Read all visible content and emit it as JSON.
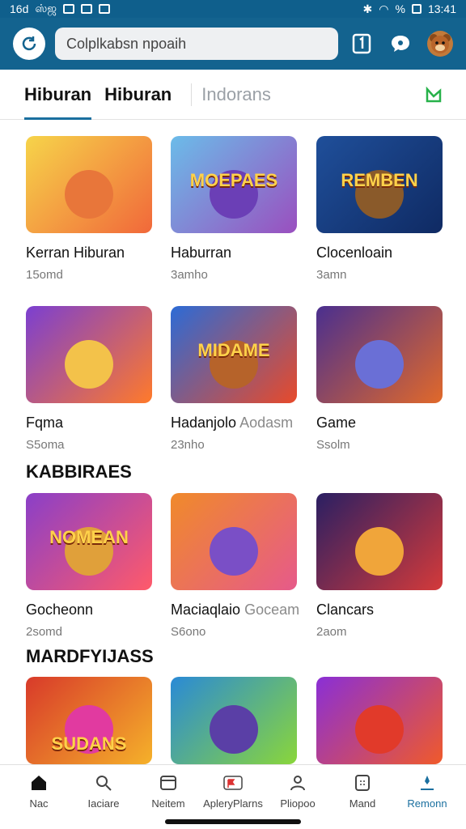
{
  "status": {
    "time_left": "16d",
    "carrier": "ஸ்ஜ",
    "battery": "%",
    "clock": "13:41"
  },
  "search": {
    "value": "Colplkabsn npoaih"
  },
  "tabs": [
    {
      "label": "Hiburan"
    },
    {
      "label": "Hiburan"
    },
    {
      "label": "Indorans"
    }
  ],
  "cards": [
    {
      "title": "Kerran Hiburan",
      "extra": "",
      "sub": "15omd",
      "thumb_text": "",
      "bg1": "#f6d44a",
      "bg2": "#f1683a",
      "m": "#e8763a"
    },
    {
      "title": "Haburran",
      "extra": "",
      "sub": "3amho",
      "thumb_text": "MOEPAES",
      "bg1": "#6bbce9",
      "bg2": "#9a4fbf",
      "m": "#6b3fb6"
    },
    {
      "title": "Clocenloain",
      "extra": "",
      "sub": "3amn",
      "thumb_text": "REMBEN",
      "bg1": "#1f4f9a",
      "bg2": "#0f2a63",
      "m": "#8a5a2a"
    },
    {
      "title": "Fqma",
      "extra": "",
      "sub": "S5oma",
      "thumb_text": "",
      "bg1": "#7b3fd1",
      "bg2": "#ff7a2a",
      "m": "#f3c24a"
    },
    {
      "title": "Hadanjolo",
      "extra": "Aodasm",
      "sub": "23nho",
      "thumb_text": "MIDAME",
      "bg1": "#2c6bd6",
      "bg2": "#e84a2a",
      "m": "#b6632a"
    },
    {
      "title": "Game",
      "extra": "",
      "sub": "Ssolm",
      "thumb_text": "",
      "bg1": "#4a2f8f",
      "bg2": "#e1692a",
      "m": "#6a6fd6"
    },
    {
      "title": "Gocheonn",
      "extra": "",
      "sub": "2somd",
      "thumb_text": "NOMEAN",
      "bg1": "#8a3fc8",
      "bg2": "#ff5a6a",
      "m": "#e0a03a"
    },
    {
      "title": "Maciaqlaio",
      "extra": "Goceam",
      "sub": "S6ono",
      "thumb_text": "",
      "bg1": "#f08a2a",
      "bg2": "#e65a8a",
      "m": "#7a4fc6"
    },
    {
      "title": "Clancars",
      "extra": "",
      "sub": "2aom",
      "thumb_text": "",
      "bg1": "#2a1f63",
      "bg2": "#d43a3a",
      "m": "#f0a53a"
    },
    {
      "title": "",
      "extra": "",
      "sub": "",
      "thumb_text": "SUDANS",
      "bg1": "#d83a2a",
      "bg2": "#f5b12a",
      "m": "#e13aa0"
    },
    {
      "title": "",
      "extra": "",
      "sub": "",
      "thumb_text": "",
      "bg1": "#2a8ad6",
      "bg2": "#8ad63a",
      "m": "#5a3fa6"
    },
    {
      "title": "",
      "extra": "",
      "sub": "",
      "thumb_text": "",
      "bg1": "#8a2fd6",
      "bg2": "#f05a2a",
      "m": "#e13a2a"
    }
  ],
  "sections": [
    {
      "label": "KABBIRAES"
    },
    {
      "label": "MARDFYIJASS"
    }
  ],
  "nav": [
    {
      "label": "Nac",
      "icon": "home-icon"
    },
    {
      "label": "Iaciare",
      "icon": "search-icon"
    },
    {
      "label": "Neitem",
      "icon": "item-icon"
    },
    {
      "label": "ApleryPlarns",
      "icon": "flag-icon"
    },
    {
      "label": "Pliopoo",
      "icon": "user-icon"
    },
    {
      "label": "Mand",
      "icon": "grid-icon"
    },
    {
      "label": "Remonn",
      "icon": "pin-icon"
    }
  ],
  "colors": {
    "header": "#13638f",
    "accent": "#1a6f9f",
    "flag": "#27b24a"
  }
}
